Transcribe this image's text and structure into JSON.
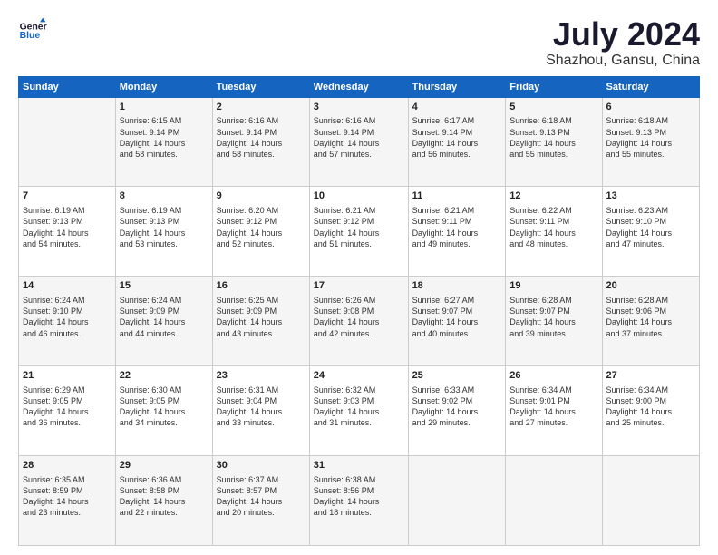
{
  "header": {
    "logo_line1": "General",
    "logo_line2": "Blue",
    "title": "July 2024",
    "subtitle": "Shazhou, Gansu, China"
  },
  "weekdays": [
    "Sunday",
    "Monday",
    "Tuesday",
    "Wednesday",
    "Thursday",
    "Friday",
    "Saturday"
  ],
  "weeks": [
    [
      {
        "day": "",
        "content": ""
      },
      {
        "day": "1",
        "content": "Sunrise: 6:15 AM\nSunset: 9:14 PM\nDaylight: 14 hours\nand 58 minutes."
      },
      {
        "day": "2",
        "content": "Sunrise: 6:16 AM\nSunset: 9:14 PM\nDaylight: 14 hours\nand 58 minutes."
      },
      {
        "day": "3",
        "content": "Sunrise: 6:16 AM\nSunset: 9:14 PM\nDaylight: 14 hours\nand 57 minutes."
      },
      {
        "day": "4",
        "content": "Sunrise: 6:17 AM\nSunset: 9:14 PM\nDaylight: 14 hours\nand 56 minutes."
      },
      {
        "day": "5",
        "content": "Sunrise: 6:18 AM\nSunset: 9:13 PM\nDaylight: 14 hours\nand 55 minutes."
      },
      {
        "day": "6",
        "content": "Sunrise: 6:18 AM\nSunset: 9:13 PM\nDaylight: 14 hours\nand 55 minutes."
      }
    ],
    [
      {
        "day": "7",
        "content": "Sunrise: 6:19 AM\nSunset: 9:13 PM\nDaylight: 14 hours\nand 54 minutes."
      },
      {
        "day": "8",
        "content": "Sunrise: 6:19 AM\nSunset: 9:13 PM\nDaylight: 14 hours\nand 53 minutes."
      },
      {
        "day": "9",
        "content": "Sunrise: 6:20 AM\nSunset: 9:12 PM\nDaylight: 14 hours\nand 52 minutes."
      },
      {
        "day": "10",
        "content": "Sunrise: 6:21 AM\nSunset: 9:12 PM\nDaylight: 14 hours\nand 51 minutes."
      },
      {
        "day": "11",
        "content": "Sunrise: 6:21 AM\nSunset: 9:11 PM\nDaylight: 14 hours\nand 49 minutes."
      },
      {
        "day": "12",
        "content": "Sunrise: 6:22 AM\nSunset: 9:11 PM\nDaylight: 14 hours\nand 48 minutes."
      },
      {
        "day": "13",
        "content": "Sunrise: 6:23 AM\nSunset: 9:10 PM\nDaylight: 14 hours\nand 47 minutes."
      }
    ],
    [
      {
        "day": "14",
        "content": "Sunrise: 6:24 AM\nSunset: 9:10 PM\nDaylight: 14 hours\nand 46 minutes."
      },
      {
        "day": "15",
        "content": "Sunrise: 6:24 AM\nSunset: 9:09 PM\nDaylight: 14 hours\nand 44 minutes."
      },
      {
        "day": "16",
        "content": "Sunrise: 6:25 AM\nSunset: 9:09 PM\nDaylight: 14 hours\nand 43 minutes."
      },
      {
        "day": "17",
        "content": "Sunrise: 6:26 AM\nSunset: 9:08 PM\nDaylight: 14 hours\nand 42 minutes."
      },
      {
        "day": "18",
        "content": "Sunrise: 6:27 AM\nSunset: 9:07 PM\nDaylight: 14 hours\nand 40 minutes."
      },
      {
        "day": "19",
        "content": "Sunrise: 6:28 AM\nSunset: 9:07 PM\nDaylight: 14 hours\nand 39 minutes."
      },
      {
        "day": "20",
        "content": "Sunrise: 6:28 AM\nSunset: 9:06 PM\nDaylight: 14 hours\nand 37 minutes."
      }
    ],
    [
      {
        "day": "21",
        "content": "Sunrise: 6:29 AM\nSunset: 9:05 PM\nDaylight: 14 hours\nand 36 minutes."
      },
      {
        "day": "22",
        "content": "Sunrise: 6:30 AM\nSunset: 9:05 PM\nDaylight: 14 hours\nand 34 minutes."
      },
      {
        "day": "23",
        "content": "Sunrise: 6:31 AM\nSunset: 9:04 PM\nDaylight: 14 hours\nand 33 minutes."
      },
      {
        "day": "24",
        "content": "Sunrise: 6:32 AM\nSunset: 9:03 PM\nDaylight: 14 hours\nand 31 minutes."
      },
      {
        "day": "25",
        "content": "Sunrise: 6:33 AM\nSunset: 9:02 PM\nDaylight: 14 hours\nand 29 minutes."
      },
      {
        "day": "26",
        "content": "Sunrise: 6:34 AM\nSunset: 9:01 PM\nDaylight: 14 hours\nand 27 minutes."
      },
      {
        "day": "27",
        "content": "Sunrise: 6:34 AM\nSunset: 9:00 PM\nDaylight: 14 hours\nand 25 minutes."
      }
    ],
    [
      {
        "day": "28",
        "content": "Sunrise: 6:35 AM\nSunset: 8:59 PM\nDaylight: 14 hours\nand 23 minutes."
      },
      {
        "day": "29",
        "content": "Sunrise: 6:36 AM\nSunset: 8:58 PM\nDaylight: 14 hours\nand 22 minutes."
      },
      {
        "day": "30",
        "content": "Sunrise: 6:37 AM\nSunset: 8:57 PM\nDaylight: 14 hours\nand 20 minutes."
      },
      {
        "day": "31",
        "content": "Sunrise: 6:38 AM\nSunset: 8:56 PM\nDaylight: 14 hours\nand 18 minutes."
      },
      {
        "day": "",
        "content": ""
      },
      {
        "day": "",
        "content": ""
      },
      {
        "day": "",
        "content": ""
      }
    ]
  ]
}
